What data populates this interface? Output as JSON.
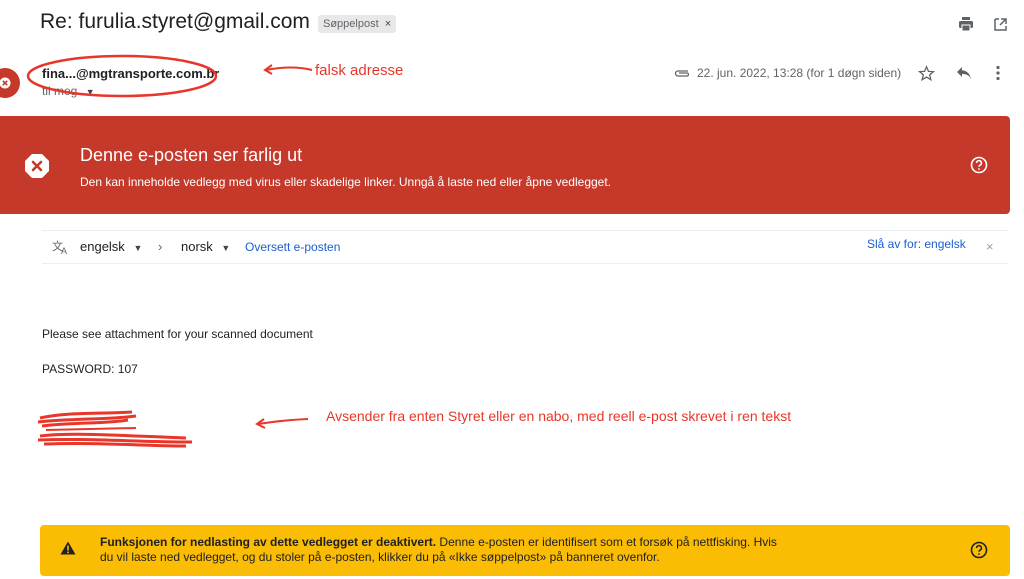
{
  "header": {
    "subject": "Re: furulia.styret@gmail.com",
    "spam_label": "Søppelpost",
    "spam_remove": "×"
  },
  "sender": {
    "address": "fina...@mgtransporte.com.br",
    "to_label": "til meg",
    "datetime": "22. jun. 2022, 13:28 (for 1 døgn siden)"
  },
  "annotations": {
    "fake_address": "falsk adresse",
    "sender_note": "Avsender fra enten Styret eller en nabo, med reell e-post skrevet i ren tekst"
  },
  "danger_banner": {
    "title": "Denne e-posten ser farlig ut",
    "description": "Den kan inneholde vedlegg med virus eller skadelige linker. Unngå å laste ned eller åpne vedlegget."
  },
  "translate_bar": {
    "from_lang": "engelsk",
    "arrow": "›",
    "to_lang": "norsk",
    "translate_link": "Oversett e-posten",
    "turn_off": "Slå av for: engelsk",
    "close": "×"
  },
  "message": {
    "line1": "Please see attachment for your scanned document",
    "line2": "PASSWORD: 107"
  },
  "warning_banner": {
    "bold": "Funksjonen for nedlasting av dette vedlegget er deaktivert.",
    "line1_rest": " Denne e-posten er identifisert som et forsøk på nettfisking. Hvis",
    "line2": "du vil laste ned vedlegget, og du stoler på e-posten, klikker du på «Ikke søppelpost» på banneret ovenfor."
  },
  "colors": {
    "danger_red": "#c5392a",
    "annotation_red": "#e8372a",
    "warning_yellow": "#fbbc04",
    "link_blue": "#1a5fd0"
  },
  "icons": [
    "print-icon",
    "open-in-new-icon",
    "attachment-icon",
    "star-icon",
    "reply-icon",
    "more-vert-icon",
    "danger-x-icon",
    "help-icon",
    "translate-icon",
    "warning-triangle-icon"
  ]
}
